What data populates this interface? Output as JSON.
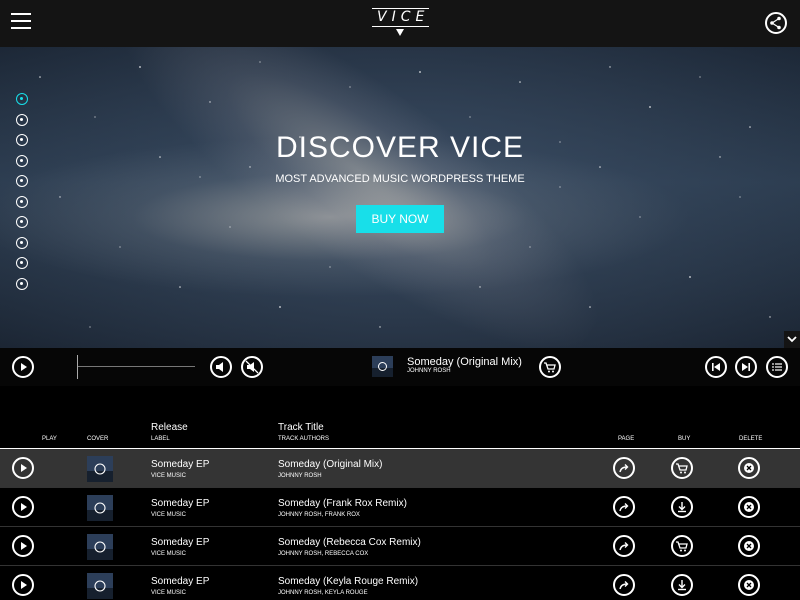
{
  "topbar": {
    "logo": "VICE",
    "menu_icon": "hamburger-icon",
    "share_icon": "share-icon"
  },
  "hero": {
    "title": "DISCOVER VICE",
    "subtitle": "MOST ADVANCED MUSIC WORDPRESS THEME",
    "button_label": "BUY NOW",
    "accent_color": "#18dfe9",
    "side_icons": [
      "bolt-icon",
      "headphones-icon",
      "star-icon",
      "trophy-icon",
      "ticket-icon",
      "cart-icon",
      "briefcase-icon",
      "list-icon",
      "pencil-icon",
      "record-icon"
    ]
  },
  "player": {
    "track_title": "Someday (Original Mix)",
    "track_artist": "JOHNNY ROSH"
  },
  "table": {
    "headers": {
      "play": "PLAY",
      "cover": "COVER",
      "release": "Release",
      "label": "LABEL",
      "track_title": "Track Title",
      "track_authors": "TRACK AUTHORS",
      "page": "PAGE",
      "buy": "BUY",
      "delete": "DELETE"
    },
    "rows": [
      {
        "release": "Someday EP",
        "label": "VICE MUSIC",
        "title": "Someday (Original Mix)",
        "authors": "JOHNNY ROSH",
        "buy_icon": "cart-icon",
        "active": true
      },
      {
        "release": "Someday EP",
        "label": "VICE MUSIC",
        "title": "Someday (Frank Rox Remix)",
        "authors": "JOHNNY ROSH, FRANK ROX",
        "buy_icon": "download-icon",
        "active": false
      },
      {
        "release": "Someday EP",
        "label": "VICE MUSIC",
        "title": "Someday (Rebecca Cox Remix)",
        "authors": "JOHNNY ROSH, REBECCA COX",
        "buy_icon": "cart-icon",
        "active": false
      },
      {
        "release": "Someday EP",
        "label": "VICE MUSIC",
        "title": "Someday (Keyla Rouge Remix)",
        "authors": "JOHNNY ROSH, KEYLA ROUGE",
        "buy_icon": "download-icon",
        "active": false
      }
    ]
  }
}
